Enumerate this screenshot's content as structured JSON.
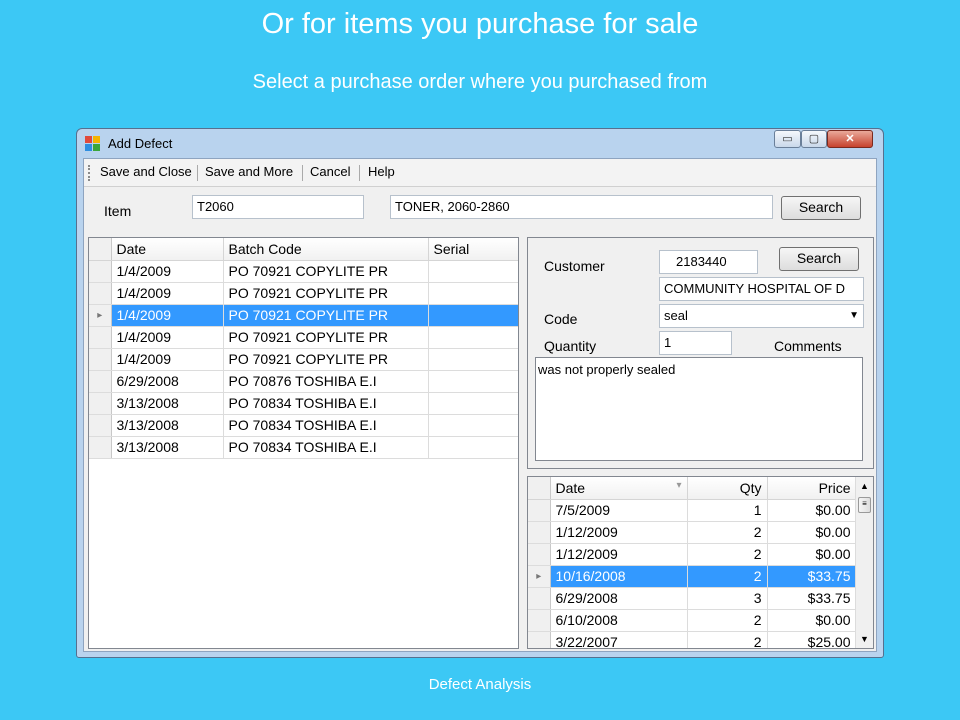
{
  "slide": {
    "title": "Or for items you purchase for sale",
    "subtitle": "Select a purchase order where you purchased from",
    "footer": "Defect Analysis"
  },
  "window": {
    "title": "Add Defect",
    "min_glyph": "▭",
    "max_glyph": "▢",
    "close_glyph": "✕"
  },
  "toolbar": {
    "save_close": "Save and Close",
    "save_more": "Save and More",
    "cancel": "Cancel",
    "help": "Help"
  },
  "item": {
    "label": "Item",
    "code": "T2060",
    "description": "TONER, 2060-2860",
    "search_label": "Search"
  },
  "batch_grid": {
    "columns": [
      "Date",
      "Batch Code",
      "Serial"
    ],
    "selected_index": 2,
    "rows": [
      [
        "1/4/2009",
        "PO 70921 COPYLITE PR",
        ""
      ],
      [
        "1/4/2009",
        "PO 70921 COPYLITE PR",
        ""
      ],
      [
        "1/4/2009",
        "PO 70921 COPYLITE PR",
        ""
      ],
      [
        "1/4/2009",
        "PO 70921 COPYLITE PR",
        ""
      ],
      [
        "1/4/2009",
        "PO 70921 COPYLITE PR",
        ""
      ],
      [
        "6/29/2008",
        "PO 70876 TOSHIBA E.I",
        ""
      ],
      [
        "3/13/2008",
        "PO 70834 TOSHIBA E.I",
        ""
      ],
      [
        "3/13/2008",
        "PO 70834 TOSHIBA E.I",
        ""
      ],
      [
        "3/13/2008",
        "PO 70834 TOSHIBA E.I",
        ""
      ]
    ]
  },
  "customer": {
    "label": "Customer",
    "id": "2183440",
    "search_label": "Search",
    "name": "COMMUNITY HOSPITAL OF D"
  },
  "code": {
    "label": "Code",
    "value": "seal"
  },
  "quantity": {
    "label": "Quantity",
    "value": "1"
  },
  "comments": {
    "label": "Comments",
    "value": "was not properly sealed"
  },
  "history_grid": {
    "columns": [
      "Date",
      "Qty",
      "Price"
    ],
    "selected_index": 3,
    "rows": [
      [
        "7/5/2009",
        "1",
        "$0.00"
      ],
      [
        "1/12/2009",
        "2",
        "$0.00"
      ],
      [
        "1/12/2009",
        "2",
        "$0.00"
      ],
      [
        "10/16/2008",
        "2",
        "$33.75"
      ],
      [
        "6/29/2008",
        "3",
        "$33.75"
      ],
      [
        "6/10/2008",
        "2",
        "$0.00"
      ],
      [
        "3/22/2007",
        "2",
        "$25.00"
      ]
    ]
  },
  "colors": {
    "background": "#3cc8f5",
    "selection": "#3399ff"
  }
}
